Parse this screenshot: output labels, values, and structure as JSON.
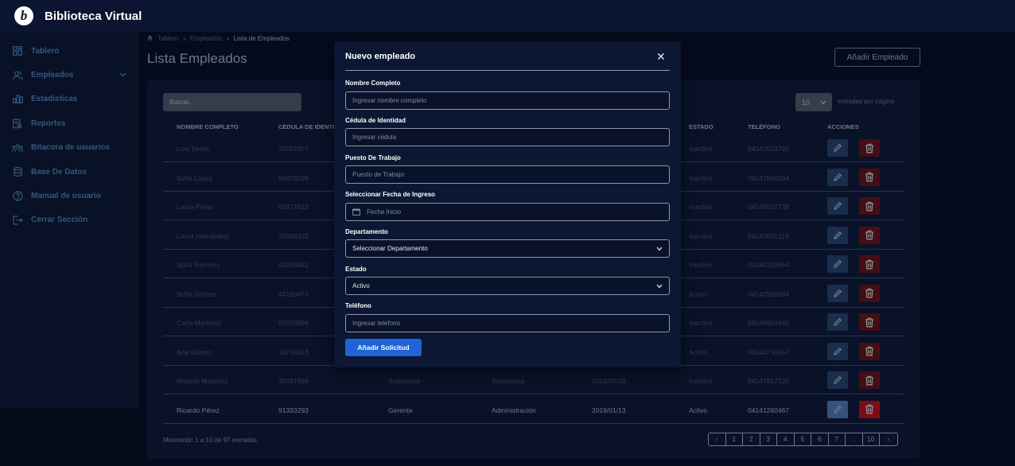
{
  "app": {
    "title": "Biblioteca Virtual",
    "logo_letter": "b"
  },
  "sidebar": {
    "items": [
      {
        "label": "Tablero",
        "icon": "grid-icon"
      },
      {
        "label": "Empleados",
        "icon": "users-icon",
        "expandable": true
      },
      {
        "label": "Estadísticas",
        "icon": "bar-chart-icon"
      },
      {
        "label": "Reportes",
        "icon": "report-icon"
      },
      {
        "label": "Bitacora de usuarios",
        "icon": "user-group-icon"
      },
      {
        "label": "Base De Datos",
        "icon": "database-icon"
      },
      {
        "label": "Manual de usuario",
        "icon": "help-icon"
      },
      {
        "label": "Cerrar Sección",
        "icon": "logout-icon"
      }
    ]
  },
  "breadcrumb": {
    "items": [
      "Tablero",
      "Empleados",
      "Lista de Empleados"
    ]
  },
  "page": {
    "title": "Lista Empleados",
    "add_button": "Añadir Empleado"
  },
  "table": {
    "search_placeholder": "Buscar...",
    "page_size": "10",
    "page_size_label": "entradas por página",
    "headers": [
      "NOMBRE COMPLETO",
      "CÉDULA DE IDENTI",
      "",
      "",
      "",
      "ESTADO",
      "TELÉFONO",
      "ACCIONES"
    ],
    "rows": [
      [
        "Luis Torres",
        "42027857",
        "",
        "",
        "",
        "Inactivo",
        "04143524791"
      ],
      [
        "Sofía López",
        "56878198",
        "",
        "",
        "",
        "Inactivo",
        "04147856284"
      ],
      [
        "Laura Pérez",
        "81477623",
        "",
        "",
        "",
        "Inactivo",
        "04145617738"
      ],
      [
        "Laura Hernández",
        "20598432",
        "",
        "",
        "",
        "Inactivo",
        "04140801219"
      ],
      [
        "Sofía Ramírez",
        "43359442",
        "",
        "",
        "",
        "Inactivo",
        "04140159864"
      ],
      [
        "Sofía Gómez",
        "44150473",
        "",
        "",
        "",
        "Activo",
        "04142555964"
      ],
      [
        "Carla Martínez",
        "65150996",
        "",
        "",
        "",
        "Inactivo",
        "04149963640"
      ],
      [
        "Ana Gómez",
        "16756413",
        "",
        "",
        "",
        "Activo",
        "04144730557"
      ],
      [
        "Ricardo Martínez",
        "30187866",
        "Supervisor",
        "Tecnología",
        "2018/02/28",
        "Inactivo",
        "04147817125"
      ],
      [
        "Ricardo Pérez",
        "91333293",
        "Gerente",
        "Administración",
        "2019/01/13",
        "Activo",
        "04141260467"
      ]
    ],
    "info": "Mostrando 1 a 10 de 97 entradas",
    "pagination": [
      "‹",
      "1",
      "2",
      "3",
      "4",
      "5",
      "6",
      "7",
      "...",
      "10",
      "›"
    ]
  },
  "modal": {
    "title": "Nuevo empleado",
    "fields": {
      "nombre": {
        "label": "Nombre Completo",
        "placeholder": "Ingresar nombre completo"
      },
      "cedula": {
        "label": "Cédula de Identidad",
        "placeholder": "Ingresar cédula"
      },
      "puesto": {
        "label": "Puesto De Trabajo",
        "placeholder": "Puesto de Trabajo"
      },
      "fecha": {
        "label": "Seleccionar Fecha de Ingreso",
        "placeholder": "Fecha Inicio"
      },
      "departamento": {
        "label": "Departamento",
        "value": "Seleccionar Departamento"
      },
      "estado": {
        "label": "Estado",
        "value": "Activo"
      },
      "telefono": {
        "label": "Teléfono",
        "placeholder": "Ingresar telefono"
      }
    },
    "submit": "Añadir Solicitud"
  },
  "colors": {
    "accent": "#1f63d6",
    "edit": "#5f8fd6",
    "delete": "#e21318",
    "sidebar_text": "#5a9bd8"
  }
}
